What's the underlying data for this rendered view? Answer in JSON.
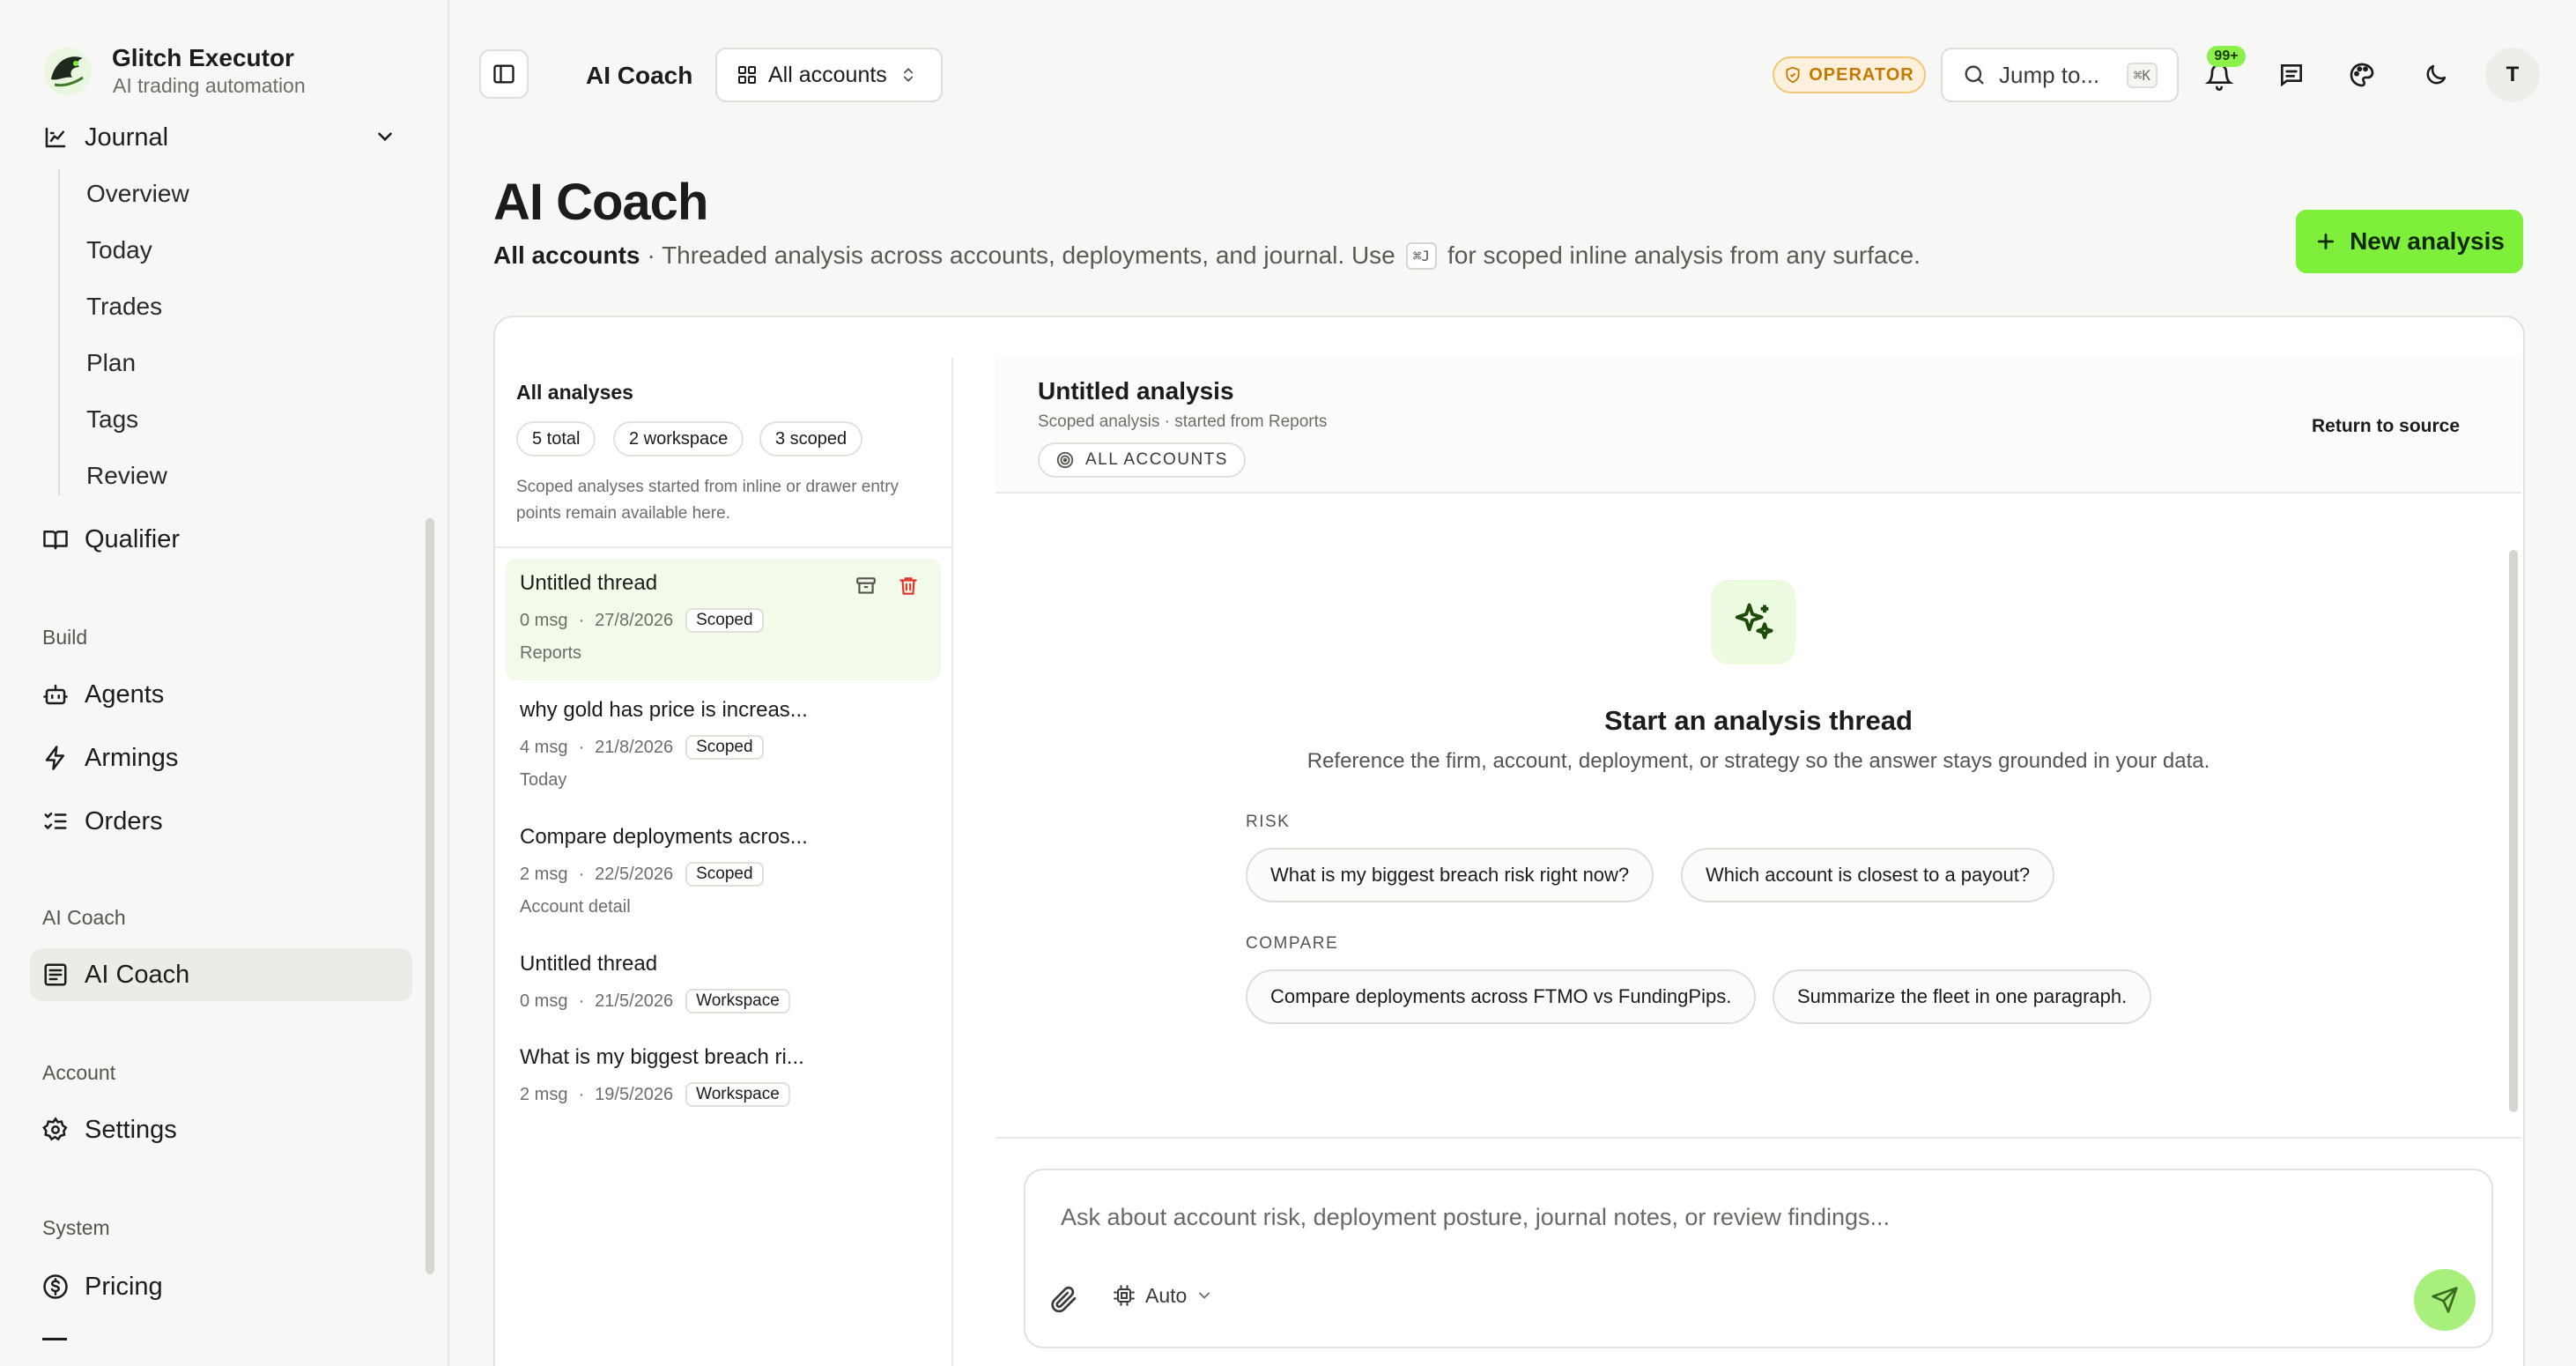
{
  "brand": {
    "name": "Glitch Executor",
    "tagline": "AI trading automation"
  },
  "sidebar": {
    "journal": {
      "label": "Journal",
      "children": [
        "Overview",
        "Today",
        "Trades",
        "Plan",
        "Tags",
        "Review"
      ]
    },
    "qualifier": "Qualifier",
    "sections": {
      "build": {
        "label": "Build",
        "items": [
          "Agents",
          "Armings",
          "Orders"
        ]
      },
      "ai_coach": {
        "label": "AI Coach",
        "items": [
          "AI Coach"
        ]
      },
      "account": {
        "label": "Account",
        "items": [
          "Settings"
        ]
      },
      "system": {
        "label": "System",
        "items": [
          "Pricing"
        ]
      }
    }
  },
  "topbar": {
    "title": "AI Coach",
    "account_select": "All accounts",
    "role_badge": "OPERATOR",
    "jump_label": "Jump to...",
    "jump_shortcut": "⌘K",
    "notif_count": "99+",
    "avatar_initial": "T"
  },
  "page": {
    "title": "AI Coach",
    "subtitle_scope": "All accounts",
    "subtitle_text": "· Threaded analysis across accounts, deployments, and journal. Use",
    "subtitle_kbd": "⌘J",
    "subtitle_tail": "for scoped inline analysis from any surface.",
    "new_button": "New analysis"
  },
  "analyses": {
    "title": "All analyses",
    "chips": [
      "5 total",
      "2 workspace",
      "3 scoped"
    ],
    "note": "Scoped analyses started from inline or drawer entry points remain available here.",
    "threads": [
      {
        "title": "Untitled thread",
        "msgs": "0 msg",
        "date": "27/8/2026",
        "tag": "Scoped",
        "source": "Reports",
        "selected": true
      },
      {
        "title": "why gold has price is increas...",
        "msgs": "4 msg",
        "date": "21/8/2026",
        "tag": "Scoped",
        "source": "Today",
        "selected": false
      },
      {
        "title": "Compare deployments acros...",
        "msgs": "2 msg",
        "date": "22/5/2026",
        "tag": "Scoped",
        "source": "Account detail",
        "selected": false
      },
      {
        "title": "Untitled thread",
        "msgs": "0 msg",
        "date": "21/5/2026",
        "tag": "Workspace",
        "source": "",
        "selected": false
      },
      {
        "title": "What is my biggest breach ri...",
        "msgs": "2 msg",
        "date": "19/5/2026",
        "tag": "Workspace",
        "source": "",
        "selected": false
      }
    ]
  },
  "thread": {
    "title": "Untitled analysis",
    "subtitle": "Scoped analysis · started from Reports",
    "scope_pill": "ALL ACCOUNTS",
    "return_link": "Return to source",
    "empty": {
      "title": "Start an analysis thread",
      "subtitle": "Reference the firm, account, deployment, or strategy so the answer stays grounded in your data."
    },
    "suggestions": {
      "risk": {
        "label": "RISK",
        "items": [
          "What is my biggest breach risk right now?",
          "Which account is closest to a payout?"
        ]
      },
      "compare": {
        "label": "COMPARE",
        "items": [
          "Compare deployments across FTMO vs FundingPips.",
          "Summarize the fleet in one paragraph."
        ]
      }
    },
    "composer": {
      "placeholder": "Ask about account risk, deployment posture, journal notes, or review findings...",
      "model": "Auto"
    }
  },
  "colors": {
    "accent": "#7ef03c",
    "operator": "#c47a00",
    "danger": "#e0342c"
  }
}
